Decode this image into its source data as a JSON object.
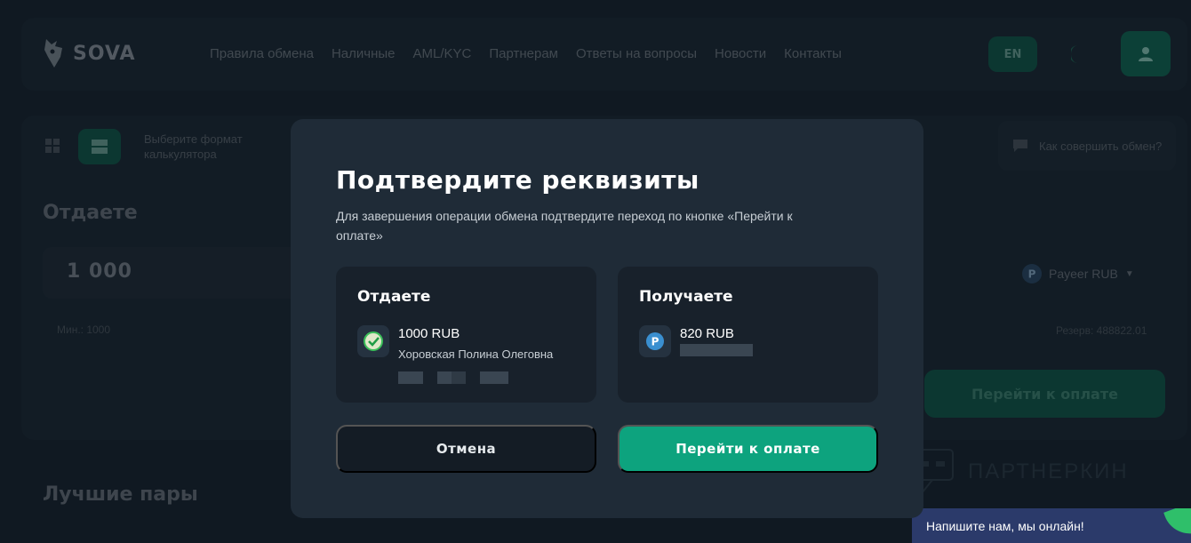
{
  "header": {
    "logo_text": "SOVA",
    "nav": [
      "Правила обмена",
      "Наличные",
      "AML/KYC",
      "Партнерам",
      "Ответы на вопросы",
      "Новости",
      "Контакты"
    ],
    "lang": "EN"
  },
  "calculator": {
    "format_hint": "Выберите формат калькулятора",
    "how_to": "Как совершить обмен?",
    "give_title": "Отдаете",
    "amount": "1 000",
    "min": "Мин.: 1000",
    "currency_select": "Payeer RUB",
    "reserve": "Резерв: 488822.01",
    "go_button": "Перейти к оплате"
  },
  "best_pairs_title": "Лучшие пары",
  "watermark": "ПАРТНЕРКИН",
  "chat": {
    "label": "Напишите нам, мы онлайн!"
  },
  "modal": {
    "title": "Подтвердите реквизиты",
    "description": "Для завершения операции обмена подтвердите переход по кнопке «Перейти к оплате»",
    "give": {
      "title": "Отдаете",
      "amount": "1000 RUB",
      "holder": "Хоровская Полина Олеговна"
    },
    "get": {
      "title": "Получаете",
      "amount": "820 RUB"
    },
    "cancel_label": "Отмена",
    "confirm_label": "Перейти к оплате"
  },
  "colors": {
    "accent": "#0da37e",
    "modal_bg": "#1f2b37",
    "panel_bg": "#18212b",
    "chat_bg": "#2b3a6a"
  }
}
